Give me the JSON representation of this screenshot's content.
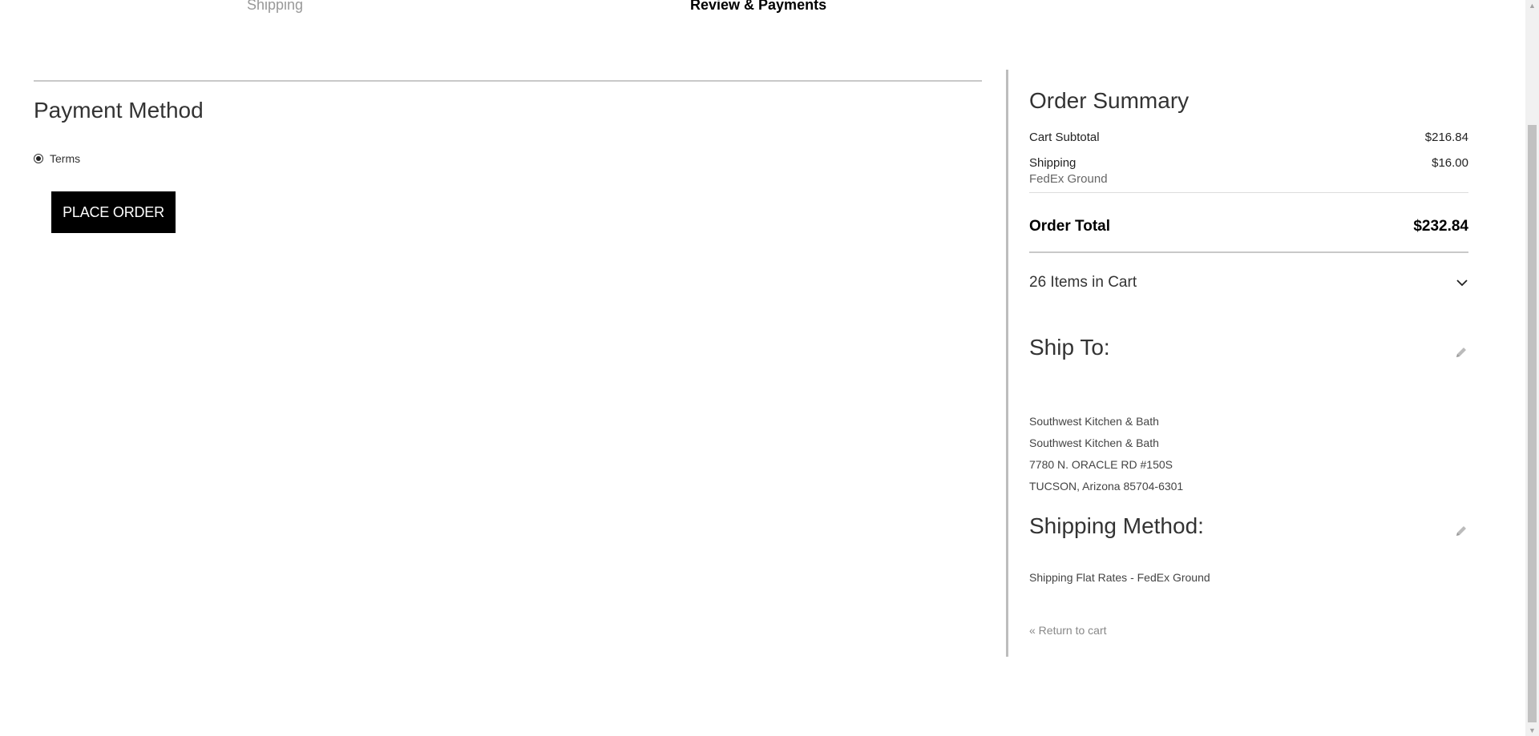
{
  "steps": {
    "shipping_label": "Shipping",
    "review_label": "Review & Payments"
  },
  "payment": {
    "title": "Payment Method",
    "option_label": "Terms",
    "place_order_label": "PLACE ORDER"
  },
  "summary": {
    "title": "Order Summary",
    "subtotal_label": "Cart Subtotal",
    "subtotal_value": "$216.84",
    "shipping_label": "Shipping",
    "shipping_value": "$16.00",
    "shipping_carrier": "FedEx Ground",
    "total_label": "Order Total",
    "total_value": "$232.84",
    "items_label": "26 Items in Cart"
  },
  "ship_to": {
    "title": "Ship To:",
    "address": [
      "Southwest Kitchen & Bath",
      "Southwest Kitchen & Bath",
      "7780 N. ORACLE RD #150S",
      "TUCSON, Arizona 85704-6301"
    ]
  },
  "shipping_method": {
    "title": "Shipping Method:",
    "value": "Shipping Flat Rates - FedEx Ground"
  },
  "return_link": "« Return to cart",
  "icons": {
    "edit": "pencil-icon",
    "toggle": "chevron-down-icon",
    "radio": "radio-selected-icon"
  },
  "colors": {
    "button_bg": "#000000",
    "divider": "#c8c8c8",
    "muted": "#999999"
  }
}
